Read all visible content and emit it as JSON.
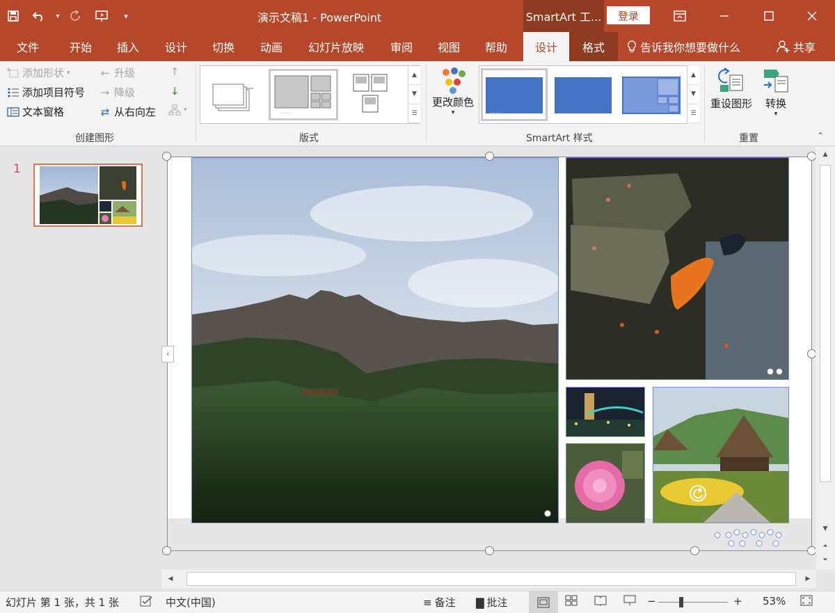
{
  "window": {
    "title": "演示文稿1  -  PowerPoint",
    "context_title": "SmartArt 工...",
    "login_label": "登录"
  },
  "tabs": {
    "file": "文件",
    "home": "开始",
    "insert": "插入",
    "design": "设计",
    "transitions": "切换",
    "animations": "动画",
    "slideshow": "幻灯片放映",
    "review": "审阅",
    "view": "视图",
    "help": "帮助",
    "smartart_design": "设计",
    "format": "格式",
    "tell_me": "告诉我你想要做什么",
    "share": "共享"
  },
  "ribbon": {
    "create_graphic": {
      "add_shape": "添加形状",
      "promote": "升级",
      "add_bullet": "添加项目符号",
      "demote": "降级",
      "text_pane": "文本窗格",
      "right_to_left": "从右向左",
      "label": "创建图形"
    },
    "layouts": {
      "label": "版式"
    },
    "styles": {
      "change_colors": "更改颜色",
      "label": "SmartArt 样式"
    },
    "reset": {
      "reset_graphic": "重设图形",
      "convert": "转换",
      "label": "重置"
    }
  },
  "slide_panel": {
    "slide_number": "1"
  },
  "status": {
    "slide_info": "幻灯片 第 1 张，共 1 张",
    "language": "中文(中国)",
    "notes": "备注",
    "comments": "批注",
    "zoom": "53%"
  },
  "colors": {
    "accent": "#b7472a",
    "accent_dark": "#8f3b22",
    "selection_border": "#6f8fd0",
    "thumbnail_selected": "#e0714e"
  }
}
